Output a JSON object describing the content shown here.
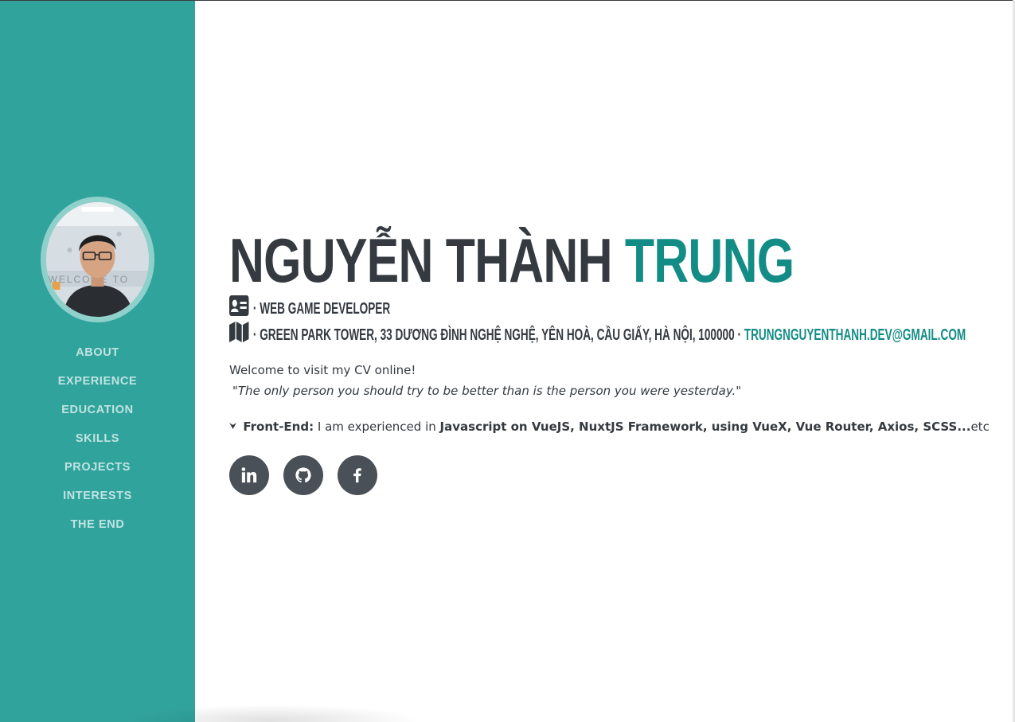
{
  "sidebar": {
    "background_color": "#31a39d",
    "avatar_alt": "profile photo",
    "nav": [
      {
        "label": "ABOUT"
      },
      {
        "label": "EXPERIENCE"
      },
      {
        "label": "EDUCATION"
      },
      {
        "label": "SKILLS"
      },
      {
        "label": "PROJECTS"
      },
      {
        "label": "INTERESTS"
      },
      {
        "label": "THE END"
      }
    ]
  },
  "profile": {
    "first_name": "NGUYỄN THÀNH",
    "last_name": "TRUNG",
    "role_icon": "id-card-icon",
    "role": "· WEB GAME DEVELOPER",
    "address_icon": "map-icon",
    "address": "· GREEN PARK TOWER, 33 DƯƠNG ĐÌNH NGHỆ NGHỆ, YÊN HOÀ, CẦU GIẤY, HÀ NỘI, 100000 ·",
    "email": "TRUNGNGUYENTHANH.DEV@GMAIL.COM",
    "welcome": "Welcome to visit my CV online!",
    "quote": "\"The only person you should try to be better than is the person you were yesterday.\"",
    "skill_label": "Front-End:",
    "skill_text": "I am experienced in",
    "skill_bold": "Javascript on VueJS, NuxtJS Framework, using VueX, Vue Router, Axios, SCSS...",
    "skill_tail": "etc"
  },
  "socials": [
    {
      "icon": "linkedin-icon"
    },
    {
      "icon": "github-icon"
    },
    {
      "icon": "facebook-icon"
    }
  ],
  "colors": {
    "accent": "#138c86",
    "text": "#343a40",
    "social_bg": "#495057"
  }
}
